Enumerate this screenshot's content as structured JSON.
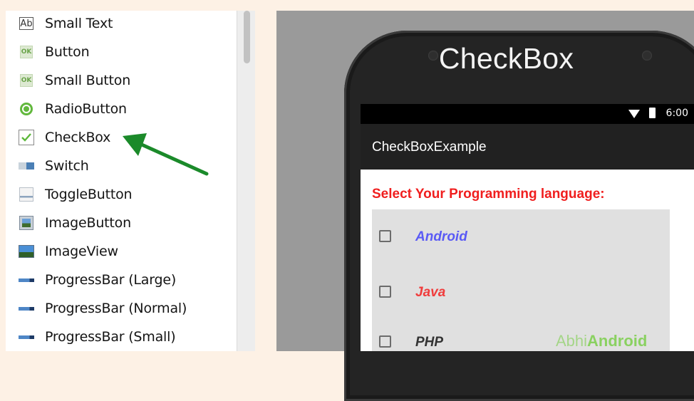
{
  "palette": {
    "widgets": [
      {
        "label": "Small Text",
        "icon": "text-ab-icon",
        "ab": "Ab"
      },
      {
        "label": "Button",
        "icon": "ok-button-icon",
        "ok": "OK"
      },
      {
        "label": "Small Button",
        "icon": "ok-button-icon",
        "ok": "OK"
      },
      {
        "label": "RadioButton",
        "icon": "radio-icon"
      },
      {
        "label": "CheckBox",
        "icon": "checkbox-icon"
      },
      {
        "label": "Switch",
        "icon": "switch-icon"
      },
      {
        "label": "ToggleButton",
        "icon": "toggle-icon"
      },
      {
        "label": "ImageButton",
        "icon": "image-button-icon"
      },
      {
        "label": "ImageView",
        "icon": "image-view-icon"
      },
      {
        "label": "ProgressBar (Large)",
        "icon": "progress-icon"
      },
      {
        "label": "ProgressBar (Normal)",
        "icon": "progress-icon"
      },
      {
        "label": "ProgressBar (Small)",
        "icon": "progress-icon"
      }
    ]
  },
  "colors": {
    "arrow": "#1b8a2a",
    "heading": "#f01e1e",
    "android": "#5a5af5",
    "java": "#f03c3c",
    "php": "#333333",
    "watermark": "#7ccf4c"
  },
  "phone": {
    "title": "CheckBox",
    "status_time": "6:00",
    "app_title": "CheckBoxExample",
    "heading": "Select Your Programming language:",
    "options": [
      {
        "label": "Android",
        "checked": false
      },
      {
        "label": "Java",
        "checked": false
      },
      {
        "label": "PHP",
        "checked": false
      }
    ],
    "watermark": {
      "part1": "Abhi",
      "part2": "Android"
    }
  }
}
